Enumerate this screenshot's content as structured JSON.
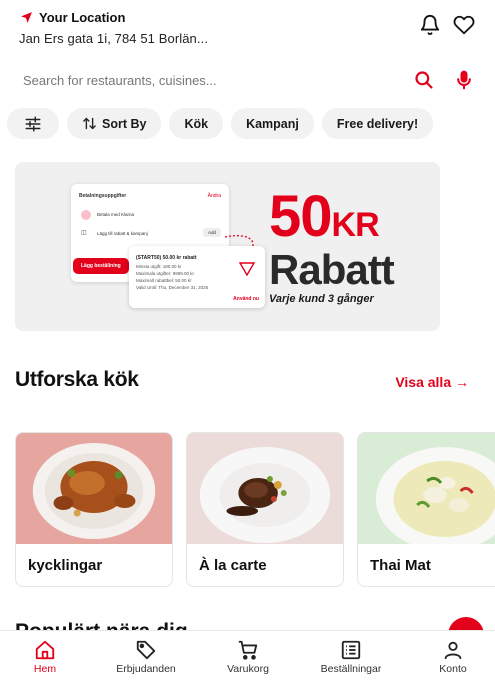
{
  "header": {
    "location_title": "Your Location",
    "address": "Jan Ers gata 1i, 784 51 Borlän..."
  },
  "search": {
    "placeholder": "Search for restaurants, cuisines..."
  },
  "filters": {
    "sort_by": "Sort By",
    "kok": "Kök",
    "kampanj": "Kampanj",
    "free_delivery": "Free delivery!"
  },
  "banner": {
    "payment_title": "Betalningsuppgifter",
    "change": "Ändra",
    "klarna": "Betala med Klarna",
    "discount_row": "Lägg till rabatt & kampanj",
    "add": "Add",
    "place_order": "Lägg beställning",
    "coupon_title": "(START50) 50.00 kr rabatt",
    "coupon_min": "Minsta utgift: 180.00 kr",
    "coupon_max_spend": "Maximala utgifter: 9999.00 kr",
    "coupon_max_discount": "Maximalt rabattbel: 50.00 kr",
    "coupon_valid": "Valid Until: Thu, December 31, 2026",
    "use_now": "Använd nu",
    "big_amount": "50",
    "big_unit": "KR",
    "rabatt": "Rabatt",
    "tagline": "Varje kund 3 gånger"
  },
  "explore": {
    "title": "Utforska kök",
    "see_all": "Visa alla →",
    "cuisines": [
      {
        "label": "kycklingar"
      },
      {
        "label": "À la carte"
      },
      {
        "label": "Thai Mat"
      }
    ]
  },
  "popular": {
    "title": "Populärt nära dig"
  },
  "nav": {
    "home": "Hem",
    "offers": "Erbjudanden",
    "cart": "Varukorg",
    "orders": "Beställningar",
    "account": "Konto"
  },
  "colors": {
    "accent": "#e3001b",
    "chip_bg": "#f2f2f2",
    "banner_bg": "#f0f0f0"
  }
}
